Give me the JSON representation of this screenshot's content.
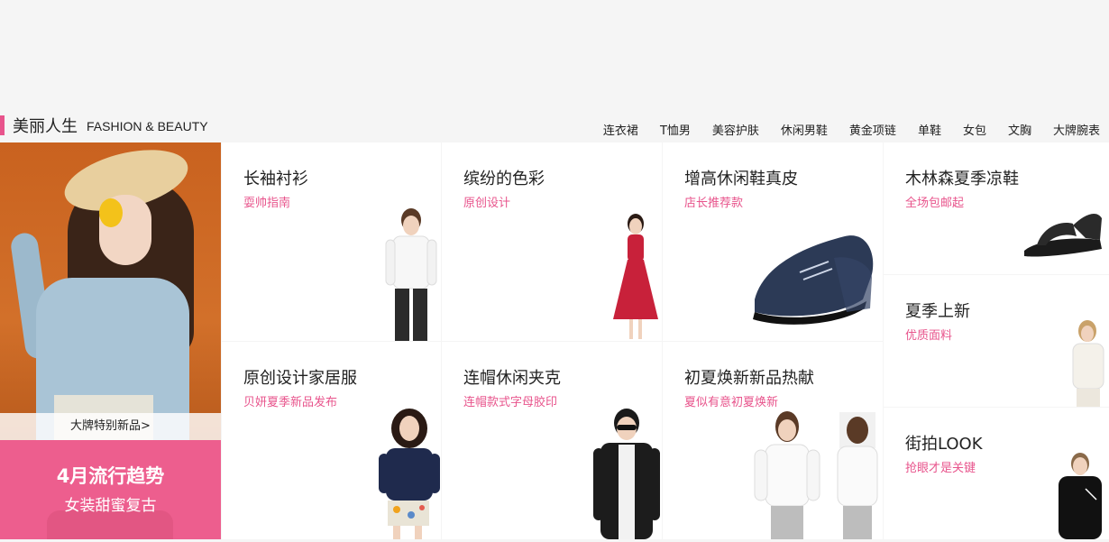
{
  "header": {
    "title": "美丽人生",
    "subtitle": "FASHION & BEAUTY",
    "nav": [
      "连衣裙",
      "T恤男",
      "美容护肤",
      "休闲男鞋",
      "黄金项链",
      "单鞋",
      "女包",
      "文胸",
      "大牌腕表"
    ]
  },
  "hero": {
    "badge": "大牌特别新品>",
    "banner_title": "4月流行趋势",
    "banner_subtitle": "女装甜蜜复古"
  },
  "tiles": [
    {
      "title": "长袖衬衫",
      "subtitle": "耍帅指南"
    },
    {
      "title": "缤纷的色彩",
      "subtitle": "原创设计"
    },
    {
      "title": "增高休闲鞋真皮",
      "subtitle": "店长推荐款"
    },
    {
      "title": "原创设计家居服",
      "subtitle": "贝妍夏季新品发布"
    },
    {
      "title": "连帽休闲夹克",
      "subtitle": "连帽款式字母胶印"
    },
    {
      "title": "初夏焕新新品热献",
      "subtitle": "夏似有意初夏焕新"
    }
  ],
  "side_tiles": [
    {
      "title": "木林森夏季凉鞋",
      "subtitle": "全场包邮起"
    },
    {
      "title": "夏季上新",
      "subtitle": "优质面料"
    },
    {
      "title": "街拍LOOK",
      "subtitle": "抢眼才是关键"
    }
  ],
  "colors": {
    "accent": "#e8548c",
    "banner": "#ed5e8e",
    "background": "#f5f5f5"
  }
}
